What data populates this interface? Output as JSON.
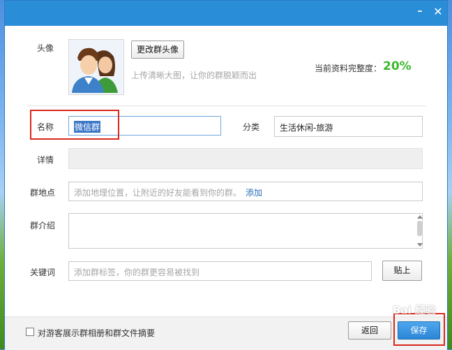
{
  "window": {
    "minimize_icon": "minimize-icon",
    "close_icon": "close-icon",
    "minimize_glyph": "–",
    "close_glyph": "✕"
  },
  "avatar": {
    "label": "头像",
    "change_button": "更改群头像",
    "hint": "上传清晰大图，让你的群脱颖而出",
    "image": "two-person-avatar-image"
  },
  "completeness": {
    "label": "当前资料完整度：",
    "value": "20%",
    "percent_value": 20,
    "color": "#3bb82e"
  },
  "form": {
    "name_label": "名称",
    "name_value": "微信群",
    "category_label": "分类",
    "category_value": "生活休闲-旅游",
    "detail_label": "详情",
    "location_label": "群地点",
    "location_placeholder": "添加地理位置，让附近的好友能看到你的群。",
    "location_link": "添加",
    "intro_label": "群介绍",
    "keyword_label": "关键词",
    "keyword_placeholder": "添加群标签，你的群更容易被找到",
    "post_button": "贴上"
  },
  "footer": {
    "checkbox_label": "对游客展示群相册和群文件摘要",
    "back_button": "返回",
    "save_button": "保存"
  },
  "watermark": "Bai 经验",
  "colors": {
    "titlebar": "#2a8dd8",
    "highlight_box": "#d9281c",
    "link": "#2b6fb6"
  }
}
